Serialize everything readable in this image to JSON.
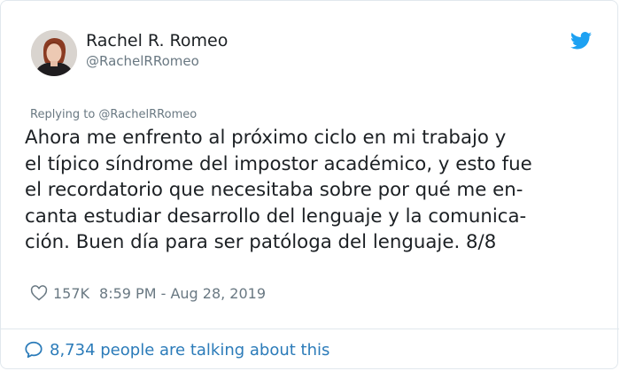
{
  "author": {
    "display_name": "Rachel R. Romeo",
    "handle": "@RachelRRomeo"
  },
  "reply_context": "Replying to @RachelRRomeo",
  "tweet_lines": [
    "Ahora me enfrento al próximo ciclo en mi trabajo y",
    "el típico síndrome del impostor académico, y esto fue",
    "el recordatorio que necesitaba sobre por qué me en-",
    "canta estudiar desarrollo del lenguaje y la comunica-",
    "ción. Buen día para ser patóloga del lenguaje. 8/8"
  ],
  "meta": {
    "likes": "157K",
    "timestamp": "8:59 PM - Aug 28, 2019"
  },
  "footer": {
    "talking_text": "8,734 people are talking about this"
  },
  "icons": {
    "brand": "twitter-bird-icon",
    "like": "heart-icon",
    "conversation": "speech-bubble-icon"
  },
  "colors": {
    "brand_blue": "#1da1f2",
    "link_blue": "#2b7bb9",
    "muted_gray": "#697882",
    "border": "#e1e8ed"
  }
}
